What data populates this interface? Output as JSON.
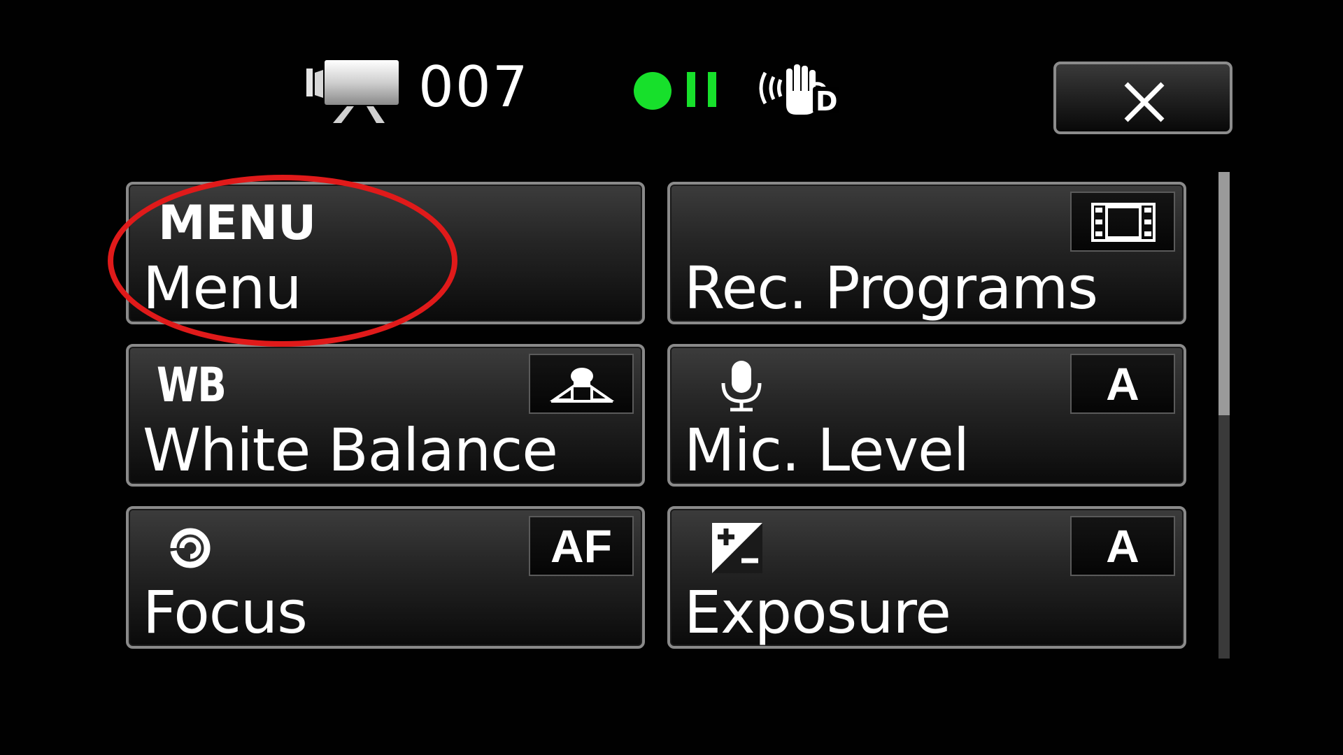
{
  "status_bar": {
    "camera_icon": "movie-camera-icon",
    "counter": "007",
    "record_state_icon": "record-pause-icon",
    "record_color": "#17e02b",
    "stabilizer_icon": "dynamic-image-stabilizer-icon"
  },
  "close_button": {
    "icon": "close-icon"
  },
  "tiles": [
    {
      "short": "MENU",
      "label": "Menu",
      "value_icon": null
    },
    {
      "short": "",
      "label": "Rec. Programs",
      "value_icon": "film-strip-icon"
    },
    {
      "short": "WB",
      "label": "White Balance",
      "value_icon": "auto-white-balance-icon"
    },
    {
      "short": "",
      "label": "Mic. Level",
      "value": "A",
      "top_icon": "microphone-icon"
    },
    {
      "short": "",
      "label": "Focus",
      "value": "AF",
      "top_icon": "focus-icon"
    },
    {
      "short": "",
      "label": "Exposure",
      "value": "A",
      "top_icon": "exposure-compensation-icon"
    }
  ],
  "scrollbar": {
    "position": 0.0,
    "visible_fraction": 0.5
  },
  "annotation": {
    "shape": "ellipse",
    "color": "#e01a1a",
    "target": "Menu"
  }
}
